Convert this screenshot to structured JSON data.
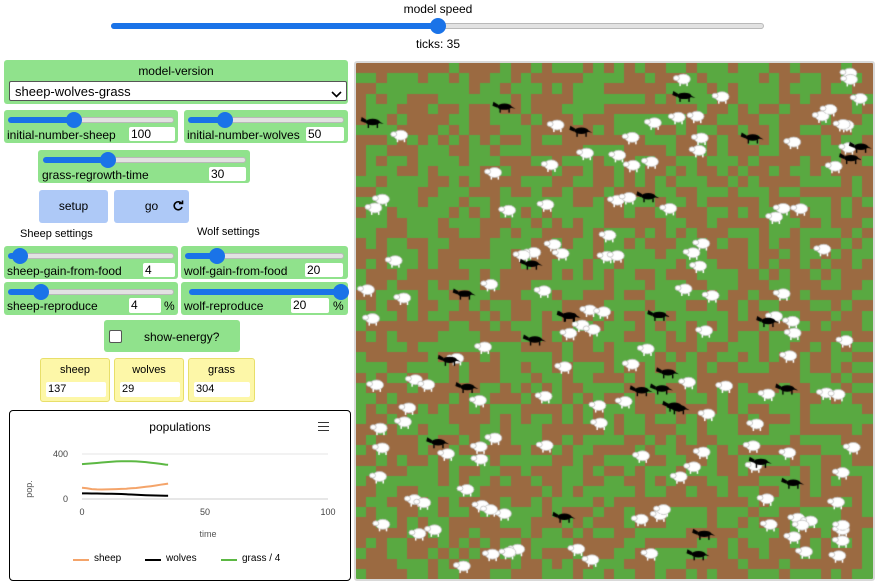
{
  "speed": {
    "label": "model speed",
    "ticks_text": "ticks: 35",
    "value": 0.5
  },
  "model_version": {
    "label": "model-version",
    "selected": "sheep-wolves-grass"
  },
  "sliders": {
    "initial_sheep": {
      "label": "initial-number-sheep",
      "value": "100",
      "fraction": 0.4
    },
    "initial_wolves": {
      "label": "initial-number-wolves",
      "value": "50",
      "fraction": 0.24
    },
    "grass_regrowth": {
      "label": "grass-regrowth-time",
      "value": "30",
      "fraction": 0.32
    },
    "sheep_gain": {
      "label": "sheep-gain-from-food",
      "value": "4",
      "fraction": 0.07
    },
    "wolf_gain": {
      "label": "wolf-gain-from-food",
      "value": "20",
      "fraction": 0.2
    },
    "sheep_reproduce": {
      "label": "sheep-reproduce",
      "value": "4",
      "unit": "%",
      "fraction": 0.2
    },
    "wolf_reproduce": {
      "label": "wolf-reproduce",
      "value": "20",
      "unit": "%",
      "fraction": 1.0
    }
  },
  "buttons": {
    "setup": "setup",
    "go": "go"
  },
  "section_labels": {
    "sheep": "Sheep settings",
    "wolf": "Wolf settings"
  },
  "show_energy": {
    "label": "show-energy?",
    "checked": false
  },
  "monitors": {
    "sheep": {
      "label": "sheep",
      "value": "137"
    },
    "wolves": {
      "label": "wolves",
      "value": "29"
    },
    "grass": {
      "label": "grass",
      "value": "304"
    }
  },
  "plot": {
    "title": "populations",
    "menu_icon": "hamburger-menu-icon",
    "ylabel": "pop.",
    "xlabel": "time",
    "yticks": [
      "400",
      "0"
    ],
    "xticks": [
      "0",
      "50",
      "100"
    ],
    "legend": [
      {
        "name": "sheep",
        "color": "#f4a46a"
      },
      {
        "name": "wolves",
        "color": "#000000"
      },
      {
        "name": "grass / 4",
        "color": "#5cb843"
      }
    ]
  },
  "chart_data": {
    "type": "line",
    "title": "populations",
    "xlabel": "time",
    "ylabel": "pop.",
    "xlim": [
      0,
      100
    ],
    "ylim": [
      0,
      400
    ],
    "legend_position": "bottom",
    "series": [
      {
        "name": "sheep",
        "color": "#f4a46a",
        "x": [
          0,
          2,
          4,
          6,
          8,
          10,
          12,
          14,
          16,
          18,
          20,
          22,
          24,
          26,
          28,
          30,
          32,
          34,
          35
        ],
        "y": [
          100,
          95,
          88,
          85,
          84,
          85,
          86,
          88,
          90,
          92,
          95,
          98,
          103,
          108,
          114,
          120,
          127,
          133,
          137
        ]
      },
      {
        "name": "wolves",
        "color": "#000000",
        "x": [
          0,
          2,
          4,
          6,
          8,
          10,
          12,
          14,
          16,
          18,
          20,
          22,
          24,
          26,
          28,
          30,
          32,
          34,
          35
        ],
        "y": [
          50,
          50,
          49,
          49,
          48,
          47,
          46,
          45,
          44,
          42,
          40,
          38,
          36,
          34,
          32,
          31,
          30,
          29,
          29
        ]
      },
      {
        "name": "grass / 4",
        "color": "#5cb843",
        "x": [
          0,
          2,
          4,
          6,
          8,
          10,
          12,
          14,
          16,
          18,
          20,
          22,
          24,
          26,
          28,
          30,
          32,
          34,
          35
        ],
        "y": [
          310,
          313,
          316,
          320,
          324,
          328,
          331,
          334,
          335,
          336,
          336,
          334,
          331,
          328,
          323,
          318,
          312,
          306,
          304
        ]
      }
    ]
  },
  "world": {
    "grass_color": "#59a941",
    "dirt_color": "#9b6a41",
    "sheep_color": "#ffffff",
    "wolf_color": "#000000"
  }
}
